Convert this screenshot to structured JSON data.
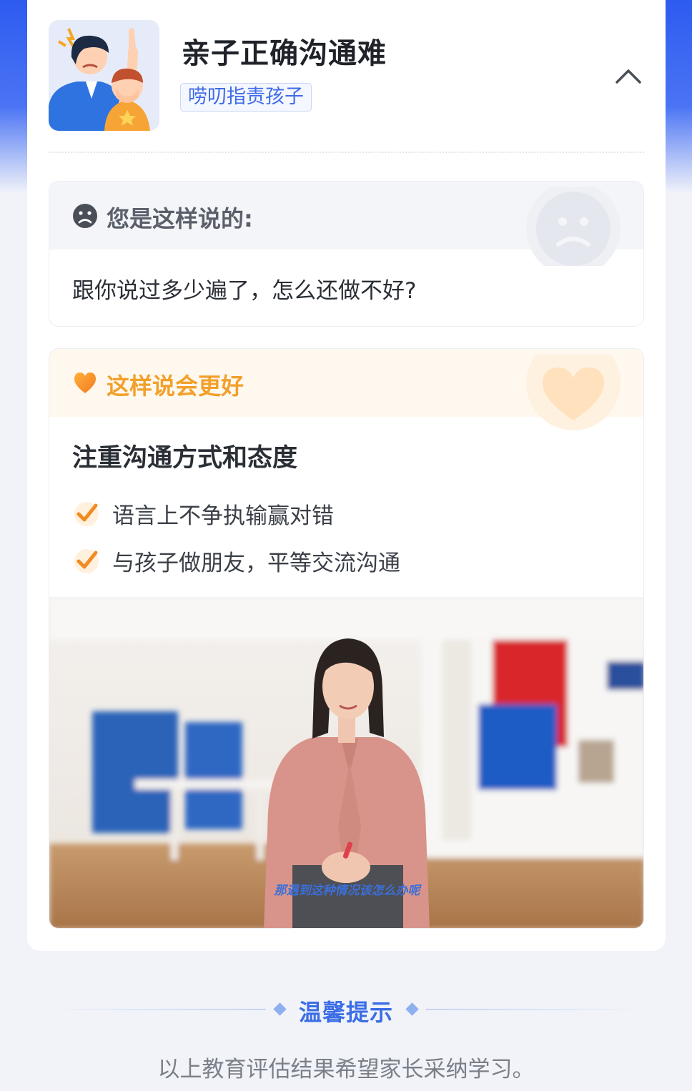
{
  "header": {
    "title": "亲子正确沟通难",
    "tag": "唠叨指责孩子",
    "collapse_icon": "chevron-up-icon"
  },
  "you_said": {
    "label": "您是这样说的:",
    "icon": "sad-face-icon",
    "quote": "跟你说过多少遍了，怎么还做不好?"
  },
  "better": {
    "label": "这样说会更好",
    "icon": "heart-icon",
    "subtitle": "注重沟通方式和态度",
    "items": [
      "语言上不争执输赢对错",
      "与孩子做朋友，平等交流沟通"
    ],
    "video_caption": "那遇到这种情况该怎么办呢"
  },
  "tip": {
    "title": "温馨提示",
    "text": "以上教育评估结果希望家长采纳学习。"
  },
  "colors": {
    "brand_blue": "#3b6de6",
    "warm_orange": "#f2a02a",
    "title_dark": "#1f2329"
  }
}
